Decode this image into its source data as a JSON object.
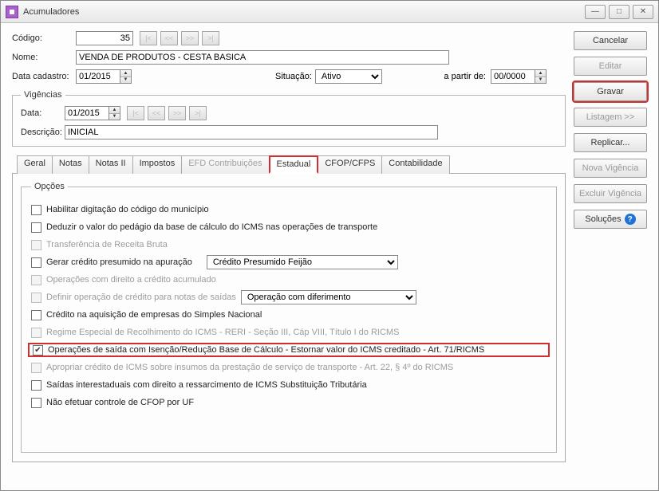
{
  "window": {
    "title": "Acumuladores"
  },
  "header": {
    "codigo_label": "Código:",
    "codigo_value": "35",
    "nome_label": "Nome:",
    "nome_value": "VENDA DE PRODUTOS - CESTA BASICA",
    "data_cadastro_label": "Data cadastro:",
    "data_cadastro_value": "01/2015",
    "situacao_label": "Situação:",
    "situacao_value": "Ativo",
    "apartir_label": "a partir de:",
    "apartir_value": "00/0000"
  },
  "vigencias": {
    "legend": "Vigências",
    "data_label": "Data:",
    "data_value": "01/2015",
    "descricao_label": "Descrição:",
    "descricao_value": "INICIAL"
  },
  "tabs": {
    "geral": "Geral",
    "notas": "Notas",
    "notas2": "Notas II",
    "impostos": "Impostos",
    "efd": "EFD Contribuições",
    "estadual": "Estadual",
    "cfop": "CFOP/CFPS",
    "contabilidade": "Contabilidade"
  },
  "options": {
    "legend": "Opções",
    "habilitar_municipio": "Habilitar digitação do código do município",
    "deduzir_pedagio": "Deduzir o valor do pedágio da base de cálculo do ICMS nas operações de transporte",
    "transferencia_receita": "Transferência de Receita Bruta",
    "gerar_credito": "Gerar crédito presumido na apuração",
    "credito_presumido_sel": "Crédito Presumido Feijão",
    "operacoes_credito_acumulado": "Operações com direito a crédito acumulado",
    "definir_operacao_credito": "Definir operação de crédito para notas de saídas",
    "operacao_diferimento_sel": "Operação com diferimento",
    "credito_simples": "Crédito na aquisição de empresas do Simples Nacional",
    "regime_reri": "Regime Especial de Recolhimento do ICMS - RERI - Seção III, Cáp VIII, Título I do RICMS",
    "operacoes_isencao": "Operações de saída com Isenção/Redução Base de Cálculo - Estornar valor do ICMS creditado - Art. 71/RICMS",
    "apropriar_credito": "Apropriar crédito de ICMS sobre insumos da prestação de serviço de transporte - Art. 22, § 4º do RICMS",
    "saidas_interestaduais": "Saídas interestaduais com direito a ressarcimento de ICMS Substituição Tributária",
    "nao_efetuar_cfop": "Não efetuar controle de CFOP por UF"
  },
  "side": {
    "cancelar": "Cancelar",
    "editar": "Editar",
    "gravar": "Gravar",
    "listagem": "Listagem >>",
    "replicar": "Replicar...",
    "nova_vigencia": "Nova Vigência",
    "excluir_vigencia": "Excluir Vigência",
    "solucoes": "Soluções"
  },
  "colors": {
    "highlight": "#d22e2e",
    "help_badge": "#1e73d6"
  }
}
